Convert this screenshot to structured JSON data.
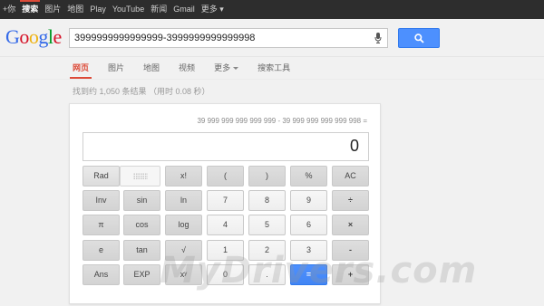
{
  "topbar": {
    "items": [
      "+你",
      "搜索",
      "图片",
      "地图",
      "Play",
      "YouTube",
      "新闻",
      "Gmail",
      "更多 ▾"
    ],
    "active_index": 1
  },
  "logo": {
    "text": "Google"
  },
  "search": {
    "query": "3999999999999999-3999999999999998"
  },
  "tabs": {
    "items": [
      "网页",
      "图片",
      "地图",
      "视频",
      "更多",
      "搜索工具"
    ],
    "active_index": 0
  },
  "result_stats": "找到约 1,050 条结果 （用时 0.08 秒）",
  "calculator": {
    "expression": "39 999 999 999 999 999 - 39 999 999 999 999 998 =",
    "result": "0",
    "keys": {
      "rad": "Rad",
      "deg": "",
      "fact": "x!",
      "lparen": "(",
      "rparen": ")",
      "percent": "%",
      "ac": "AC",
      "inv": "Inv",
      "sin": "sin",
      "ln": "ln",
      "seven": "7",
      "eight": "8",
      "nine": "9",
      "divide": "÷",
      "pi": "π",
      "cos": "cos",
      "log": "log",
      "four": "4",
      "five": "5",
      "six": "6",
      "multiply": "×",
      "e": "e",
      "tan": "tan",
      "sqrt": "√",
      "one": "1",
      "two": "2",
      "three": "3",
      "minus": "-",
      "ans": "Ans",
      "exp": "EXP",
      "pow": "xʸ",
      "zero": "0",
      "dot": ".",
      "equals": "=",
      "plus": "+"
    }
  },
  "watermark": "MyDrivers.com",
  "colors": {
    "accent_red": "#dd4b39",
    "search_blue": "#4d90fe",
    "topbar": "#2d2d2d"
  }
}
